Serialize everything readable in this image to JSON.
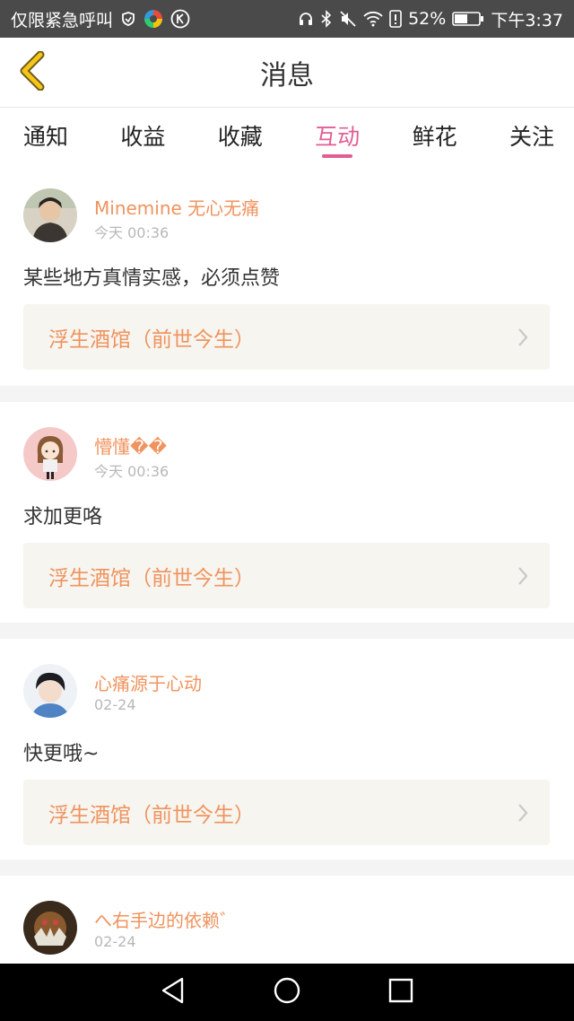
{
  "status_bar": {
    "carrier_text": "仅限紧急呼叫",
    "battery_percent": "52%",
    "time": "下午3:37",
    "icons": [
      "shield-icon",
      "color-app-icon",
      "k-icon",
      "headphones-icon",
      "bluetooth-icon",
      "mute-icon",
      "wifi-icon",
      "alert-icon",
      "battery-icon"
    ]
  },
  "header": {
    "title": "消息",
    "back_icon": "chevron-left-icon",
    "accent_color": "#f5c518"
  },
  "tabs": [
    {
      "label": "通知",
      "active": false
    },
    {
      "label": "收益",
      "active": false
    },
    {
      "label": "收藏",
      "active": false
    },
    {
      "label": "互动",
      "active": true
    },
    {
      "label": "鲜花",
      "active": false
    },
    {
      "label": "关注",
      "active": false
    }
  ],
  "colors": {
    "active_tab": "#e25d94",
    "username": "#f0935e",
    "link_bg": "#f6f5ef"
  },
  "messages": [
    {
      "username": "Minemine 无心无痛",
      "time": "今天 00:36",
      "comment": "某些地方真情实感，必须点赞",
      "book": "浮生酒馆（前世今生）"
    },
    {
      "username": "懵懂��",
      "time": "今天 00:36",
      "comment": "求加更咯",
      "book": "浮生酒馆（前世今生）"
    },
    {
      "username": "心痛源于心动",
      "time": "02-24",
      "comment": "快更哦~",
      "book": "浮生酒馆（前世今生）"
    },
    {
      "username": "へ右手边的依赖゛",
      "time": "02-24",
      "comment": "",
      "book": ""
    }
  ],
  "nav_bar": {
    "icons": [
      "back-triangle-icon",
      "home-circle-icon",
      "recents-square-icon"
    ]
  }
}
